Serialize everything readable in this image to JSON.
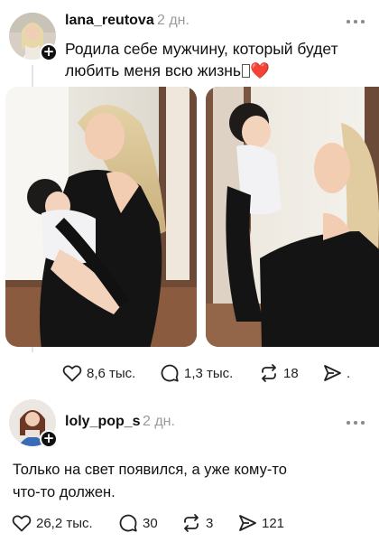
{
  "posts": [
    {
      "username": "lana_reutova",
      "time": "2 дн.",
      "text_line1": "Родила себе мужчину, который будет",
      "text_line2": "любить меня всю жизнь",
      "text_emoji": "❤️",
      "actions": {
        "likes": "8,6 тыс.",
        "comments": "1,3 тыс.",
        "reposts": "18",
        "shares": "."
      },
      "icons": {
        "like": "heart-icon",
        "comment": "comment-bubble-icon",
        "repost": "repost-icon",
        "share": "share-icon",
        "more": "more-dots-icon",
        "follow": "plus-icon"
      }
    },
    {
      "username": "loly_pop_s",
      "time": "2 дн.",
      "text_line1": "Только на свет появился, а уже кому-то",
      "text_line2": "что-то должен.",
      "actions": {
        "likes": "26,2 тыс.",
        "comments": "30",
        "reposts": "3",
        "shares": "121"
      },
      "icons": {
        "like": "heart-icon",
        "comment": "comment-bubble-icon",
        "repost": "repost-icon",
        "share": "share-icon",
        "more": "more-dots-icon",
        "follow": "plus-icon"
      }
    }
  ],
  "colors": {
    "text": "#111111",
    "muted": "#9a9a9a",
    "line": "#e3e3e3",
    "heart": "#e0245e"
  }
}
